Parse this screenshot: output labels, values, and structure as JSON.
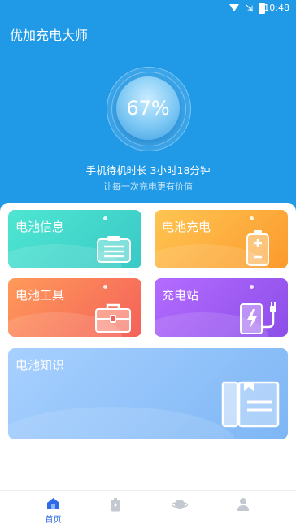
{
  "status_bar": {
    "time": "10:48"
  },
  "app": {
    "title": "优加充电大师"
  },
  "battery": {
    "percent_text": "67%",
    "standby": "手机待机时长 3小时18分钟",
    "slogan": "让每一次充电更有价值"
  },
  "cards": [
    {
      "label": "电池信息",
      "icon": "clipboard-icon"
    },
    {
      "label": "电池充电",
      "icon": "battery-icon"
    },
    {
      "label": "电池工具",
      "icon": "toolbox-icon"
    },
    {
      "label": "充电站",
      "icon": "charging-station-icon"
    },
    {
      "label": "电池知识",
      "icon": "book-icon"
    }
  ],
  "nav": {
    "items": [
      {
        "label": "首页",
        "icon": "home-icon",
        "active": true
      },
      {
        "label": "",
        "icon": "battery-nav-icon"
      },
      {
        "label": "",
        "icon": "planet-icon"
      },
      {
        "label": "",
        "icon": "user-icon"
      }
    ],
    "active_color": "#2f6be6",
    "inactive_color": "#c4c8d0"
  },
  "colors": {
    "header": "#2099e6"
  }
}
